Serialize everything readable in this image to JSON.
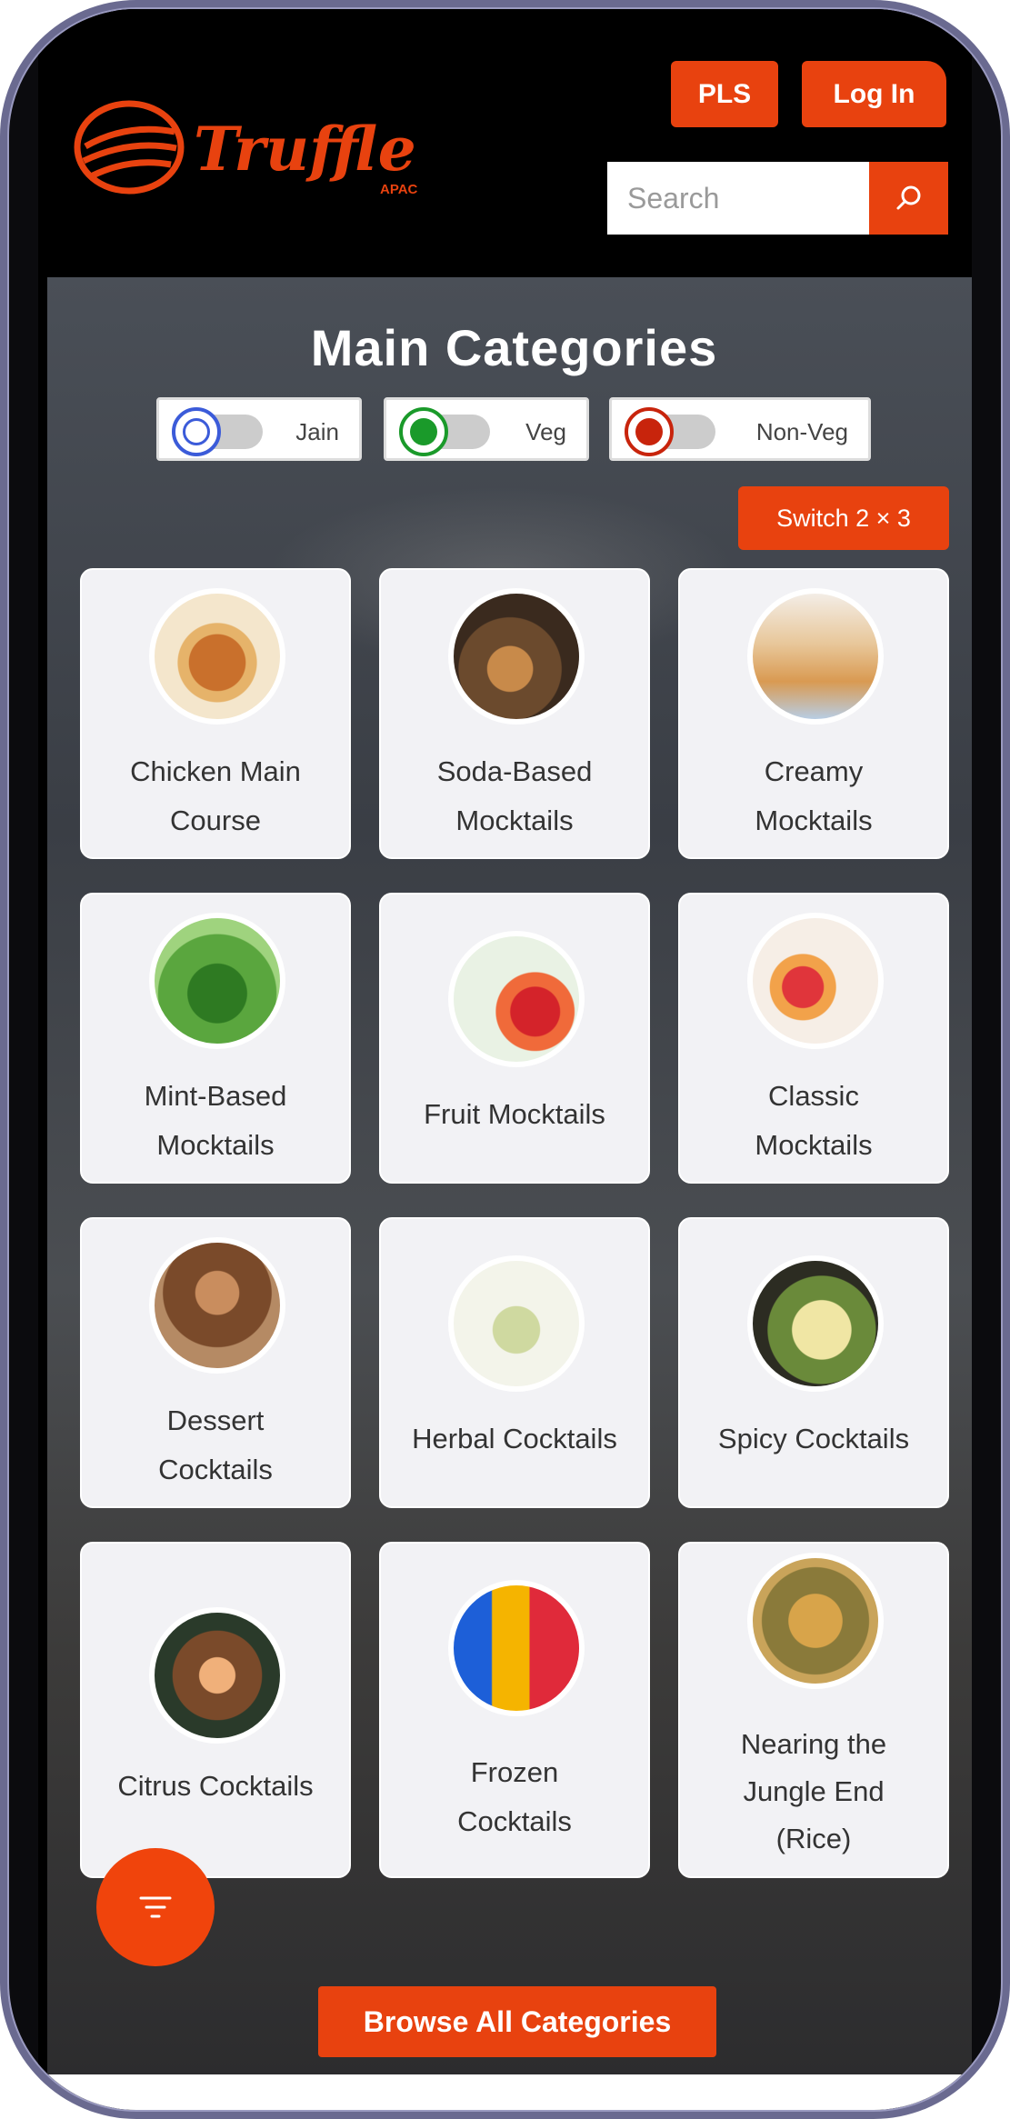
{
  "header": {
    "logo_text": "Truffle",
    "logo_sub": "APAC",
    "pls_label": "PLS",
    "login_label": "Log In",
    "search_placeholder": "Search"
  },
  "main": {
    "title": "Main Categories",
    "toggles": [
      {
        "label": "Jain",
        "color": "#3b5bd9"
      },
      {
        "label": "Veg",
        "color": "#1a9a2a"
      },
      {
        "label": "Non-Veg",
        "color": "#c8240c"
      }
    ],
    "switch_label": "Switch 2 × 3",
    "cards": [
      {
        "label": "Chicken Main Course",
        "lines": [
          "Chicken Main",
          "Course"
        ]
      },
      {
        "label": "Soda-Based Mocktails",
        "lines": [
          "Soda-Based",
          "Mocktails"
        ]
      },
      {
        "label": "Creamy Mocktails",
        "lines": [
          "Creamy",
          "Mocktails"
        ]
      },
      {
        "label": "Mint-Based Mocktails",
        "lines": [
          "Mint-Based",
          "Mocktails"
        ]
      },
      {
        "label": "Fruit Mocktails",
        "lines": [
          "Fruit Mocktails"
        ]
      },
      {
        "label": "Classic Mocktails",
        "lines": [
          "Classic",
          "Mocktails"
        ]
      },
      {
        "label": "Dessert Cocktails",
        "lines": [
          "Dessert",
          "Cocktails"
        ]
      },
      {
        "label": "Herbal Cocktails",
        "lines": [
          "Herbal Cocktails"
        ]
      },
      {
        "label": "Spicy Cocktails",
        "lines": [
          "Spicy Cocktails"
        ]
      },
      {
        "label": "Citrus Cocktails",
        "lines": [
          "Citrus Cocktails"
        ]
      },
      {
        "label": "Frozen Cocktails",
        "lines": [
          "Frozen",
          "Cocktails"
        ]
      },
      {
        "label": "Nearing the Jungle End (Rice)",
        "lines": [
          "Nearing the",
          "Jungle End",
          "(Rice)"
        ]
      }
    ],
    "browse_label": "Browse All Categories"
  },
  "colors": {
    "accent": "#e8420f"
  },
  "icons": {
    "search": "search-icon",
    "filter": "filter-icon"
  }
}
